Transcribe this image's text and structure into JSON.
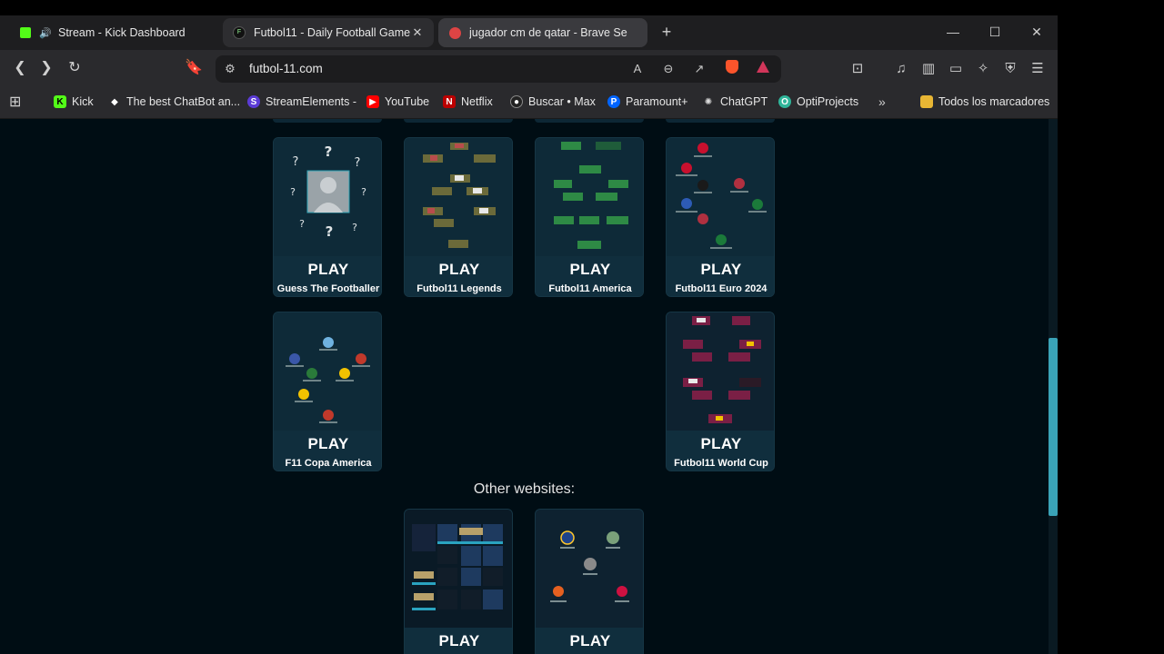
{
  "tabs": [
    {
      "title": "Stream - Kick Dashboard",
      "icon": "kick-icon"
    },
    {
      "title": "Futbol11 - Daily Football Game",
      "icon": "futbol11-icon"
    },
    {
      "title": "jugador cm de qatar - Brave Se",
      "icon": "brave-search-icon"
    }
  ],
  "address": {
    "url": "futbol-11.com"
  },
  "bookmarks": [
    {
      "label": "Kick"
    },
    {
      "label": "The best ChatBot an..."
    },
    {
      "label": "StreamElements -"
    },
    {
      "label": "YouTube"
    },
    {
      "label": "Netflix"
    },
    {
      "label": "Buscar • Max"
    },
    {
      "label": "Paramount+"
    },
    {
      "label": "ChatGPT"
    },
    {
      "label": "OptiProjects"
    },
    {
      "label": "Todos los marcadores"
    }
  ],
  "games": [
    {
      "play": "PLAY",
      "name": "Guess The Footballer"
    },
    {
      "play": "PLAY",
      "name": "Futbol11 Legends"
    },
    {
      "play": "PLAY",
      "name": "Futbol11 America"
    },
    {
      "play": "PLAY",
      "name": "Futbol11 Euro 2024"
    },
    {
      "play": "PLAY",
      "name": "F11 Copa America"
    },
    {
      "play": "PLAY",
      "name": "Futbol11 World Cup"
    }
  ],
  "other": {
    "heading": "Other websites:",
    "cards": [
      {
        "play": "PLAY"
      },
      {
        "play": "PLAY"
      }
    ]
  },
  "colors": {
    "accent": "#3aa3b7",
    "page_bg": "#000d14",
    "card_bg": "#0d2735"
  }
}
